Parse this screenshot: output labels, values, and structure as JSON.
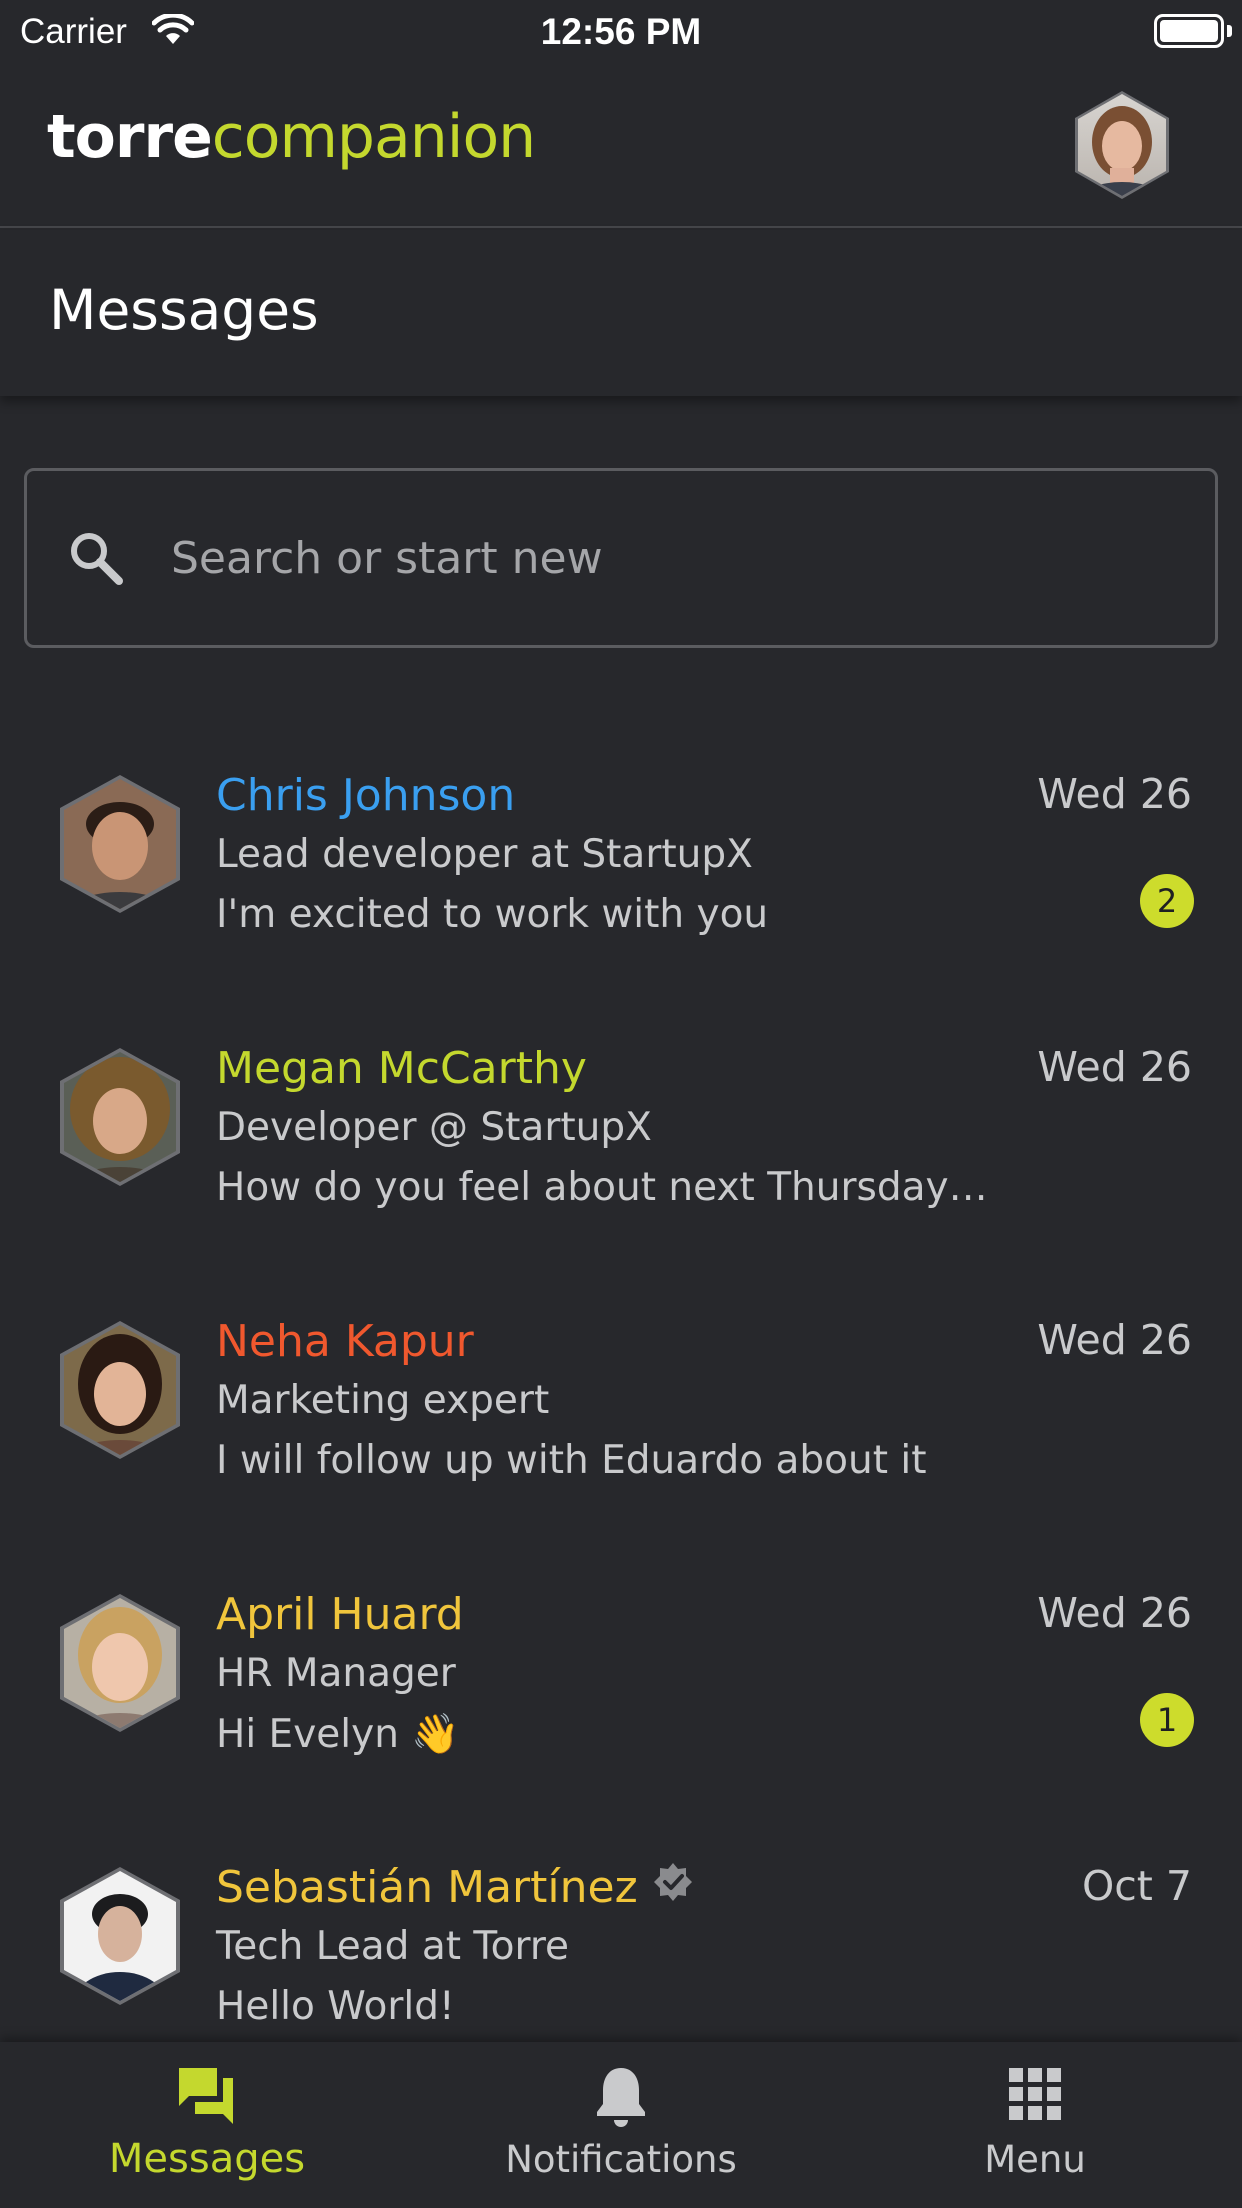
{
  "status_bar": {
    "carrier": "Carrier",
    "time": "12:56 PM"
  },
  "header": {
    "brand_primary": "torre",
    "brand_secondary": "companion"
  },
  "page": {
    "title": "Messages"
  },
  "search": {
    "placeholder": "Search or start new",
    "value": ""
  },
  "messages": [
    {
      "name": "Chris Johnson",
      "name_color": "#3a9ff0",
      "subtitle": "Lead developer at StartupX",
      "preview": "I'm excited to work with you",
      "date": "Wed 26",
      "unread": "2"
    },
    {
      "name": "Megan McCarthy",
      "name_color": "#c4d82e",
      "subtitle": "Developer @ StartupX",
      "preview": "How do you feel about next Thursday ...",
      "date": "Wed 26",
      "unread": ""
    },
    {
      "name": "Neha Kapur",
      "name_color": "#f0582e",
      "subtitle": "Marketing expert",
      "preview": "I will follow up with Eduardo about it",
      "date": "Wed 26",
      "unread": ""
    },
    {
      "name": "April Huard",
      "name_color": "#f0c53c",
      "subtitle": "HR Manager",
      "preview": "Hi Evelyn 👋",
      "date": "Wed 26",
      "unread": "1"
    },
    {
      "name": "Sebastián Martínez",
      "name_color": "#f0c53c",
      "subtitle": "Tech Lead at Torre",
      "preview": "Hello World!",
      "date": "Oct 7",
      "unread": "",
      "verified": true
    }
  ],
  "tabbar": {
    "items": [
      {
        "label": "Messages",
        "icon": "chat-icon",
        "active": true
      },
      {
        "label": "Notifications",
        "icon": "bell-icon",
        "active": false
      },
      {
        "label": "Menu",
        "icon": "grid-icon",
        "active": false
      }
    ]
  },
  "colors": {
    "background": "#27282c",
    "accent": "#c4d82e",
    "badge": "#cddc2c",
    "divider": "#45464a"
  }
}
